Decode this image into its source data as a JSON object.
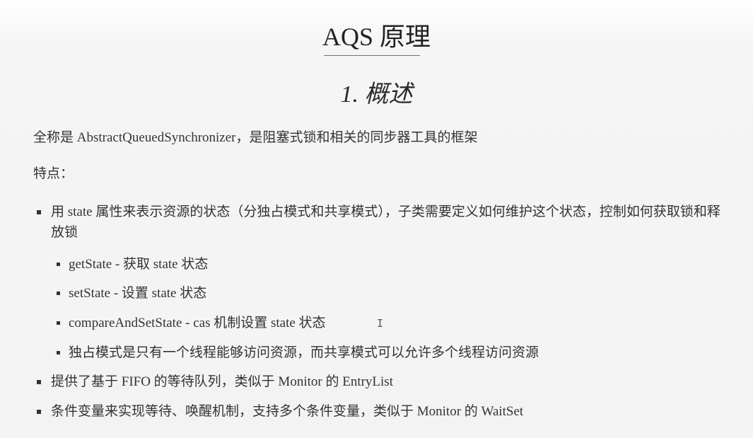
{
  "document": {
    "title": "AQS 原理",
    "section_heading": "1. 概述",
    "intro": "全称是 AbstractQueuedSynchronizer，是阻塞式锁和相关的同步器工具的框架",
    "features_label": "特点：",
    "bullets": [
      {
        "text": "用 state 属性来表示资源的状态（分独占模式和共享模式），子类需要定义如何维护这个状态，控制如何获取锁和释放锁",
        "sub_items": [
          "getState - 获取 state 状态",
          "setState - 设置 state 状态",
          "compareAndSetState - cas 机制设置 state 状态",
          "独占模式是只有一个线程能够访问资源，而共享模式可以允许多个线程访问资源"
        ]
      },
      {
        "text": "提供了基于 FIFO 的等待队列，类似于 Monitor 的 EntryList"
      },
      {
        "text": "条件变量来实现等待、唤醒机制，支持多个条件变量，类似于 Monitor 的 WaitSet"
      }
    ]
  },
  "cursor": {
    "icon": "text-cursor-icon",
    "glyph": "I"
  },
  "colors": {
    "background": "#f4f4f4",
    "text": "#333333",
    "title_rule": "#6f6f6f"
  }
}
